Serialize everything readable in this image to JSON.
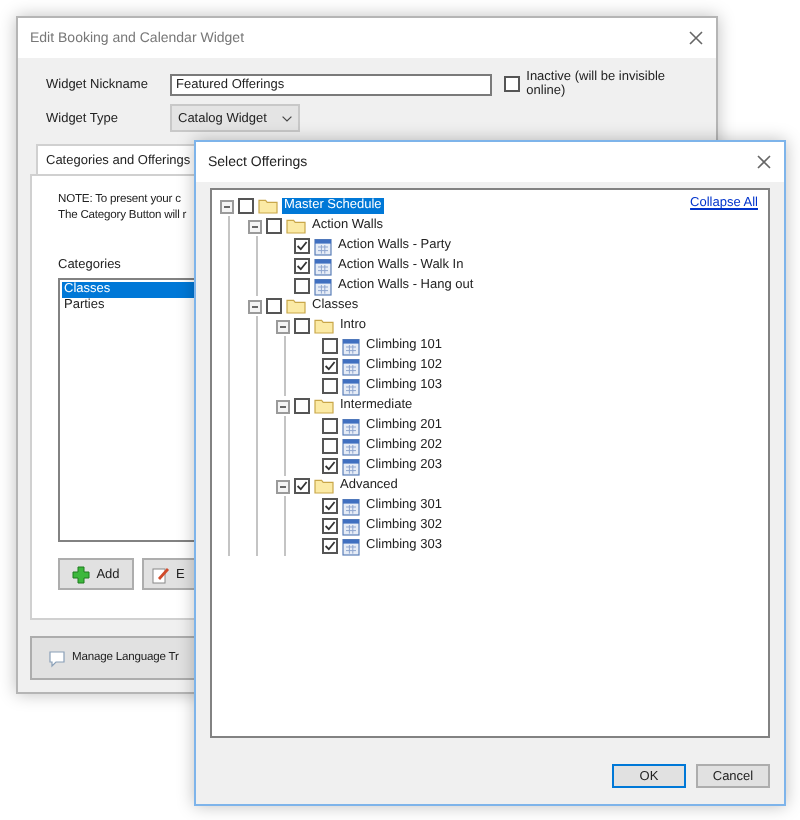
{
  "back_window": {
    "title": "Edit Booking and Calendar Widget",
    "nickname_label": "Widget Nickname",
    "nickname_value": "Featured Offerings",
    "inactive": {
      "label": "Inactive (will be invisible online)",
      "checked": false
    },
    "type_label": "Widget Type",
    "type_value": "Catalog Widget",
    "tabs": [
      {
        "label": "Categories and Offerings",
        "selected": true
      }
    ],
    "note_lines": [
      "NOTE: To present your c",
      "The Category Button will r"
    ],
    "categories_label": "Categories",
    "categories": [
      {
        "label": "Classes",
        "selected": true
      },
      {
        "label": "Parties",
        "selected": false
      }
    ],
    "buttons": [
      {
        "label": "Add",
        "kind": "plus"
      },
      {
        "label": "E",
        "kind": "edit"
      }
    ],
    "language_button": "Manage Language Tr"
  },
  "dialog": {
    "title": "Select Offerings",
    "collapse_link": "Collapse All",
    "tree": [
      {
        "label": "Master Schedule",
        "kind": "folder",
        "checked": false,
        "selected": true,
        "expanded": true,
        "children": [
          {
            "label": "Action Walls",
            "kind": "folder",
            "checked": false,
            "selected": false,
            "expanded": true,
            "children": [
              {
                "label": "Action Walls - Party",
                "kind": "offering",
                "checked": true,
                "selected": false
              },
              {
                "label": "Action Walls - Walk In",
                "kind": "offering",
                "checked": true,
                "selected": false
              },
              {
                "label": "Action Walls - Hang out",
                "kind": "offering",
                "checked": false,
                "selected": false
              }
            ]
          },
          {
            "label": "Classes",
            "kind": "folder",
            "checked": false,
            "selected": false,
            "expanded": true,
            "children": [
              {
                "label": "Intro",
                "kind": "folder",
                "checked": false,
                "selected": false,
                "expanded": true,
                "children": [
                  {
                    "label": "Climbing 101",
                    "kind": "offering",
                    "checked": false,
                    "selected": false
                  },
                  {
                    "label": "Climbing 102",
                    "kind": "offering",
                    "checked": true,
                    "selected": false
                  },
                  {
                    "label": "Climbing 103",
                    "kind": "offering",
                    "checked": false,
                    "selected": false
                  }
                ]
              },
              {
                "label": "Intermediate",
                "kind": "folder",
                "checked": false,
                "selected": false,
                "expanded": true,
                "children": [
                  {
                    "label": "Climbing 201",
                    "kind": "offering",
                    "checked": false,
                    "selected": false
                  },
                  {
                    "label": "Climbing 202",
                    "kind": "offering",
                    "checked": false,
                    "selected": false
                  },
                  {
                    "label": "Climbing 203",
                    "kind": "offering",
                    "checked": true,
                    "selected": false
                  }
                ]
              },
              {
                "label": "Advanced",
                "kind": "folder",
                "checked": true,
                "selected": false,
                "expanded": true,
                "children": [
                  {
                    "label": "Climbing 301",
                    "kind": "offering",
                    "checked": true,
                    "selected": false
                  },
                  {
                    "label": "Climbing 302",
                    "kind": "offering",
                    "checked": true,
                    "selected": false
                  },
                  {
                    "label": "Climbing 303",
                    "kind": "offering",
                    "checked": true,
                    "selected": false
                  }
                ]
              }
            ]
          }
        ]
      }
    ],
    "buttons": [
      {
        "label": "OK",
        "default": true
      },
      {
        "label": "Cancel",
        "default": false
      }
    ]
  }
}
